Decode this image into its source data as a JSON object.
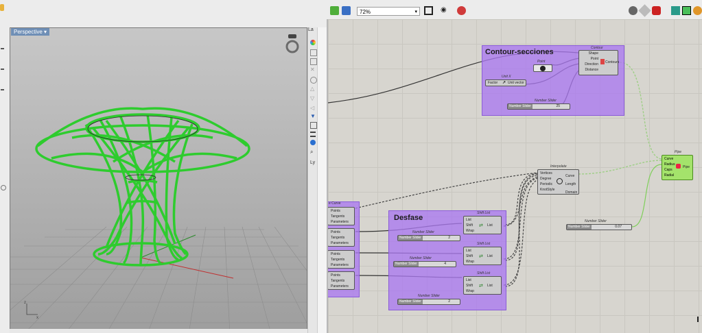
{
  "rhino": {
    "viewport_tab": "Perspective",
    "panel_tab": "La",
    "panel_bottom": "Ly",
    "axis_labels": {
      "z": "z",
      "x": "x"
    }
  },
  "gh": {
    "zoom": "72%",
    "contour_group": {
      "title": "Contour-secciones",
      "component_caption": "Contour",
      "inputs": [
        "Shape",
        "Point",
        "Direction",
        "Distance"
      ],
      "output": "Contours",
      "point_caption": "Point",
      "unit_caption": "Unit X",
      "unit_in": "Factor",
      "unit_out": "Unit vector",
      "slider_caption": "Number Slider",
      "slider_label": "Number Slider",
      "slider_value": "25"
    },
    "interpolate": {
      "caption": "Interpolate",
      "inputs": [
        "Vertices",
        "Degree",
        "Periodic",
        "KnotStyle"
      ],
      "outputs": [
        "Curve",
        "Length",
        "Domain"
      ]
    },
    "pipe": {
      "caption": "Pipe",
      "inputs": [
        "Curve",
        "Radius",
        "Caps",
        "Radial"
      ],
      "output": "Pipe"
    },
    "radius_slider": {
      "caption": "Number Slider",
      "label": "Number Slider",
      "value": "0.07"
    },
    "divide_group": {
      "title": "e Curve",
      "items": [
        {
          "points": "Points",
          "tangents": "Tangents",
          "parameters": "Parameters"
        },
        {
          "points": "Points",
          "tangents": "Tangents",
          "parameters": "Parameters"
        },
        {
          "points": "Points",
          "tangents": "Tangents",
          "parameters": "Parameters"
        },
        {
          "points": "Points",
          "tangents": "Tangents",
          "parameters": "Parameters"
        }
      ]
    },
    "desfase_group": {
      "title": "Desfase",
      "shifts": [
        {
          "caption": "Shift List",
          "inputs": [
            "List",
            "Shift",
            "Wrap"
          ],
          "output": "List",
          "slider_caption": "Number Slider",
          "slider_label": "Number Slider",
          "slider_value": "2"
        },
        {
          "caption": "Shift List",
          "inputs": [
            "List",
            "Shift",
            "Wrap"
          ],
          "output": "List",
          "slider_caption": "Number Slider",
          "slider_label": "Number Slider",
          "slider_value": "4"
        },
        {
          "caption": "Shift List",
          "inputs": [
            "List",
            "Shift",
            "Wrap"
          ],
          "output": "List",
          "slider_caption": "Number Slider",
          "slider_label": "Number Slider",
          "slider_value": "2"
        }
      ]
    }
  },
  "colors": {
    "group_purple": "#aa78f0",
    "pipe_green": "#a4e36b",
    "mesh_green": "#33cc33",
    "canvas": "#d7d5cf"
  }
}
